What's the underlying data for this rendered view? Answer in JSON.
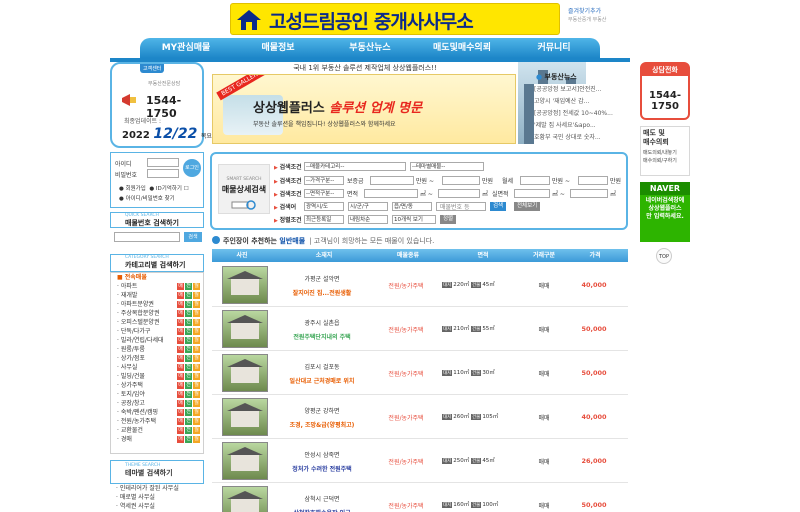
{
  "header": {
    "logo_main": "고성드림공인",
    "logo_sub": "중개사사무소",
    "bookmark": "즐겨찾기추가",
    "bookmark_sub": "부동산중개 부동산"
  },
  "nav": {
    "items": [
      "MY관심매물",
      "매물정보",
      "부동산뉴스",
      "매도및매수의뢰",
      "커뮤니티"
    ]
  },
  "phone_box": {
    "tag": "고객센터",
    "title": "부동산전문상담",
    "number": "1544-1750",
    "date_label": "최종업데이트 :",
    "year": "2022",
    "date": "12/22",
    "day": "목요일"
  },
  "banner": {
    "top_text": "국내 1위 부동산 솔루션 제작업체 상상웹플러스!!",
    "badge": "BEST GALLERY",
    "title_plain": "상상웹플러스",
    "title_red": "솔루션 업계 명문",
    "subtitle": "부동산 솔루션을 책임집니다! 상상웹플러스와 함께하세요"
  },
  "news": {
    "title": "부동산뉴스",
    "items": [
      "[공공앙정 보고서]안전진...",
      "고양시 '재입예산 감...",
      "[공공앙정] 전세값 10~40%...",
      "'제발 집 사세요'&apo...",
      "호황부 국민 상대로 숫자..."
    ]
  },
  "right": {
    "call_head": "상담전화",
    "call_num_1": "1544-",
    "call_num_2": "1750",
    "req_title_1": "매도 및",
    "req_title_2": "매수의뢰",
    "req_links": [
      "매도의뢰/내놓기",
      "매수의뢰/구하기"
    ],
    "naver_head": "NAVER",
    "naver_lines": [
      "네이버검색창에",
      "상상웹플러스",
      "만 입력하세요."
    ],
    "top": "TOP"
  },
  "login": {
    "id_label": "아이디",
    "pw_label": "비밀번호",
    "btn": "로그인",
    "join": "회원가입",
    "save": "ID기억하기",
    "find": "아이디/비밀번호 찾기"
  },
  "number_search": {
    "small": "QUICK SEARCH",
    "title": "매물번호 검색하기",
    "btn": "검색"
  },
  "category": {
    "small": "CATEGORY SEARCH",
    "title": "카테고리별 검색하기",
    "items": [
      "전속매물",
      "아파트",
      "재개발",
      "아파트분양권",
      "주상복합분양권",
      "오피스텔분양권",
      "단독/다가구",
      "빌라/연립/다세대",
      "원룸/투룸",
      "상가/점포",
      "사무실",
      "빌딩/건물",
      "상가주택",
      "토지/임야",
      "공장/창고",
      "숙박/펜션/캠핑",
      "전원/농가주택",
      "교환물건",
      "경매"
    ],
    "chips": [
      "매",
      "전",
      "월"
    ]
  },
  "theme": {
    "small": "THEME SEARCH",
    "title": "테마별 검색하기",
    "items": [
      "인테리어가 잘된 사무실",
      "매로별 사무실",
      "역세권 사무실"
    ]
  },
  "detail_search": {
    "small": "SMART SEARCH",
    "title": "매물상세검색",
    "r1_label": "검색조건",
    "r1_sel1": "--매물카테고리--",
    "r1_sel2": "--테마별매물--",
    "r2_label": "검색조건",
    "r2_sel1": "--가격구분--",
    "r2_txt1": "보증금",
    "r2_txt2": "만원 ~",
    "r2_txt3": "만원",
    "r2_txt4": "월세",
    "r2_txt5": "만원 ~",
    "r2_txt6": "만원",
    "r3_label": "검색조건",
    "r3_sel1": "--면적구분--",
    "r3_txt1": "면적",
    "r3_txt2": "㎡ ~",
    "r3_txt3": "㎡",
    "r3_txt4": "실면적",
    "r3_txt5": "㎡ ~",
    "r3_txt6": "㎡",
    "r4_label": "검색어",
    "r4_sel1": "광역시/도",
    "r4_sel2": "시/군/구",
    "r4_sel3": "읍/면/동",
    "r4_txt": "매물번호 등",
    "r4_btn1": "검색",
    "r4_btn2": "전체보기",
    "r5_label": "정렬조건",
    "r5_sel1": "최근등록일",
    "r5_sel2": "내림차순",
    "r5_sel3": "10개씩 보기",
    "r5_btn": "정렬"
  },
  "listing": {
    "title_a": "주인장이 추천하는",
    "title_b": "일반매물",
    "title_c": "고객님이 희망하는 모든 매물이 있습니다.",
    "headers": [
      "사진",
      "소재지",
      "매물종류",
      "면적",
      "거래구분",
      "가격"
    ],
    "rows": [
      {
        "loc": "가평군 설악면",
        "desc": "잘지어진 집...전원생활",
        "type": "전원/농가주택",
        "a1": "220㎡",
        "a2": "45㎡",
        "deal": "매매",
        "price": "40,000"
      },
      {
        "loc": "광주시 실촌읍",
        "desc": "전원주택단지내의 주택",
        "type": "전원/농가주택",
        "a1": "210㎡",
        "a2": "55㎡",
        "deal": "매매",
        "price": "50,000"
      },
      {
        "loc": "김포시 걸포동",
        "desc": "일산대교 근처경매로 위치",
        "type": "전원/농가주택",
        "a1": "110㎡",
        "a2": "30㎡",
        "deal": "매매",
        "price": "50,000"
      },
      {
        "loc": "양평군 강하면",
        "desc": "조경, 조망&급(양평최고)",
        "type": "전원/농가주택",
        "a1": "260㎡",
        "a2": "105㎡",
        "deal": "매매",
        "price": "40,000"
      },
      {
        "loc": "안성시 삼죽면",
        "desc": "정처가 수려한 전원주택",
        "type": "전원/농가주택",
        "a1": "250㎡",
        "a2": "45㎡",
        "deal": "매매",
        "price": "26,000"
      },
      {
        "loc": "삼척시 근덕면",
        "desc": "삼척잡호해수욕장 인근",
        "type": "전원/농가주택",
        "a1": "160㎡",
        "a2": "100㎡",
        "deal": "매매",
        "price": "50,000"
      }
    ],
    "tag1": "대지",
    "tag2": "건물"
  }
}
